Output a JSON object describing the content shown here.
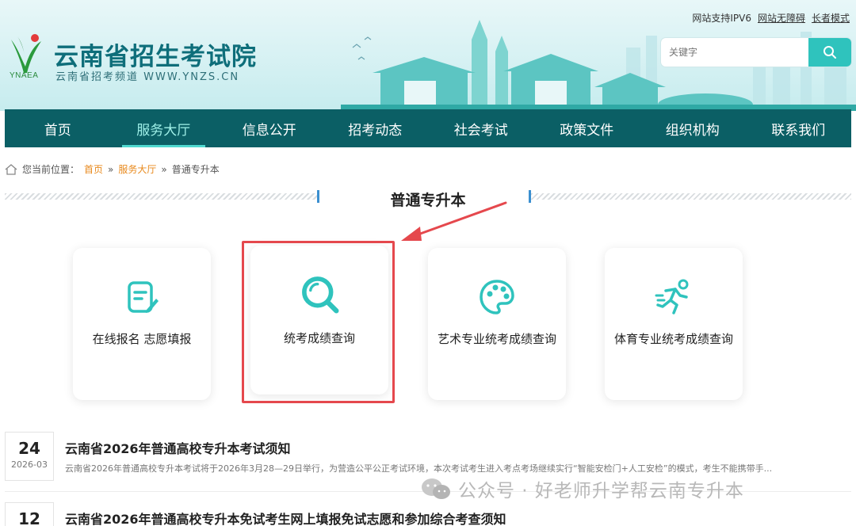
{
  "header": {
    "title": "云南省招生考试院",
    "subtitle": "云南省招考频道 WWW.YNZS.CN",
    "logo_abbr": "YNAEA",
    "links": [
      "网站支持IPV6",
      "网站无障碍",
      "长者模式"
    ],
    "search_placeholder": "关键字"
  },
  "nav": {
    "items": [
      {
        "label": "首页"
      },
      {
        "label": "服务大厅"
      },
      {
        "label": "信息公开"
      },
      {
        "label": "招考动态"
      },
      {
        "label": "社会考试"
      },
      {
        "label": "政策文件"
      },
      {
        "label": "组织机构"
      },
      {
        "label": "联系我们"
      }
    ],
    "active_index": 1
  },
  "breadcrumb": {
    "prefix": "您当前位置：",
    "items": [
      "首页",
      "服务大厅",
      "普通专升本"
    ],
    "separator": "»"
  },
  "section": {
    "title": "普通专升本"
  },
  "cards": [
    {
      "label": "在线报名 志愿填报",
      "icon": "form-edit-icon"
    },
    {
      "label": "统考成绩查询",
      "icon": "search-icon"
    },
    {
      "label": "艺术专业统考成绩查询",
      "icon": "palette-icon"
    },
    {
      "label": "体育专业统考成绩查询",
      "icon": "runner-icon"
    }
  ],
  "news": [
    {
      "day": "24",
      "ym": "2026-03",
      "title": "云南省2026年普通高校专升本考试须知",
      "desc": "云南省2026年普通高校专升本考试将于2026年3月28—29日举行，为营造公平公正考试环境，本次考试考生进入考点考场继续实行“智能安检门+人工安检”的模式，考生不能携带手..."
    },
    {
      "day": "12",
      "ym": "",
      "title": "云南省2026年普通高校专升本免试考生网上填报免试志愿和参加综合考查须知",
      "desc": ""
    }
  ],
  "watermark": {
    "text": "公众号 · 好老师升学帮云南专升本"
  },
  "colors": {
    "nav_bg": "#0b5f65",
    "accent": "#2fc3bd",
    "highlight": "#e5484d",
    "breadcrumb_link": "#e8891c"
  }
}
